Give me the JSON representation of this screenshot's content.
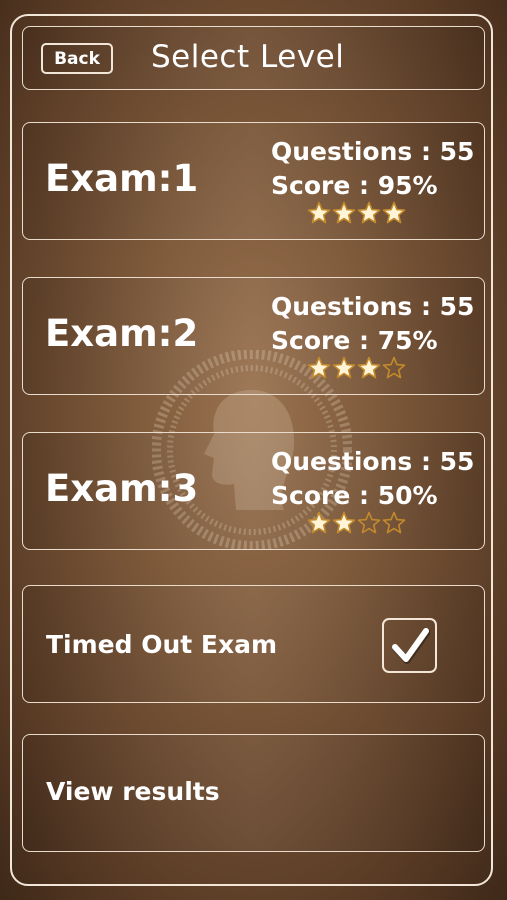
{
  "header": {
    "back_label": "Back",
    "title": "Select Level"
  },
  "exams": [
    {
      "name": "Exam:1",
      "questions": "Questions : 55",
      "score": "Score : 95%",
      "stars": 4,
      "max_stars": 4
    },
    {
      "name": "Exam:2",
      "questions": "Questions : 55",
      "score": "Score : 75%",
      "stars": 3,
      "max_stars": 4
    },
    {
      "name": "Exam:3",
      "questions": "Questions : 55",
      "score": "Score : 50%",
      "stars": 2,
      "max_stars": 4
    }
  ],
  "timed": {
    "label": "Timed Out Exam",
    "checked": true
  },
  "results": {
    "label": "View results"
  },
  "icons": {
    "star_filled": "star-filled-icon",
    "star_empty": "star-empty-icon",
    "check": "checkmark-icon",
    "watermark": "head-profile-logo"
  },
  "colors": {
    "background_center": "#9a7350",
    "background_edge": "#3e2818",
    "border": "#f2e6d8",
    "star_fill": "#fff5d6",
    "star_outline": "#c28a2c"
  }
}
